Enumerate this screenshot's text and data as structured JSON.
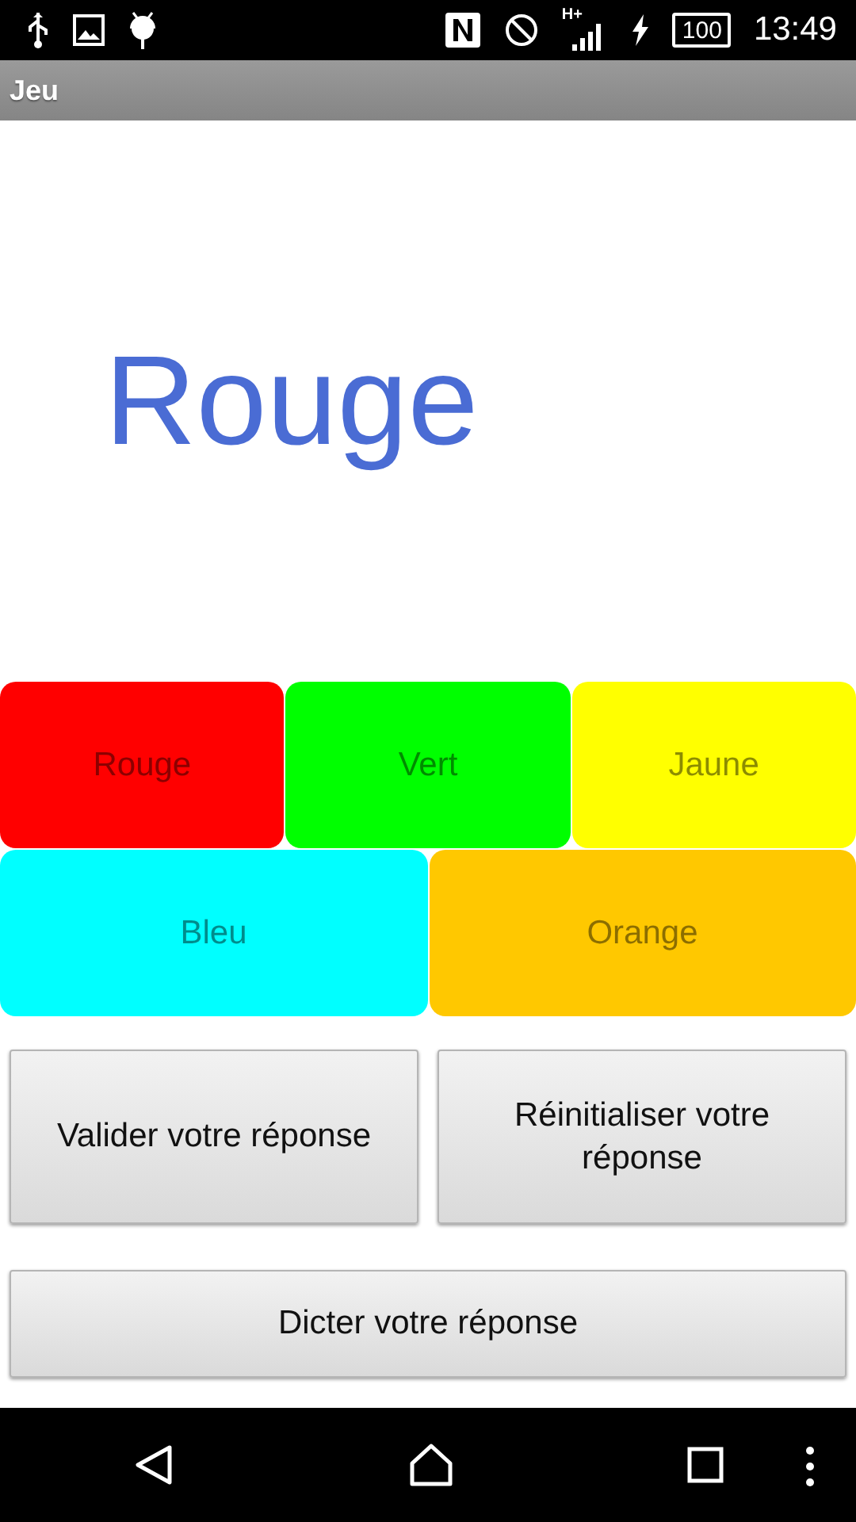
{
  "status_bar": {
    "network": "H+",
    "battery": "100",
    "time": "13:49"
  },
  "app_bar": {
    "title": "Jeu"
  },
  "prompt_word": {
    "text": "Rouge",
    "color": "#4a6cd4"
  },
  "color_rows": [
    [
      {
        "label": "Rouge",
        "color": "#ff0000"
      },
      {
        "label": "Vert",
        "color": "#00ff00"
      },
      {
        "label": "Jaune",
        "color": "#ffff00"
      }
    ],
    [
      {
        "label": "Bleu",
        "color": "#00ffff"
      },
      {
        "label": "Orange",
        "color": "#ffc800"
      }
    ]
  ],
  "action_buttons": [
    "Valider votre réponse",
    "Réinitialiser votre réponse"
  ],
  "dictate_button": "Dicter votre réponse"
}
